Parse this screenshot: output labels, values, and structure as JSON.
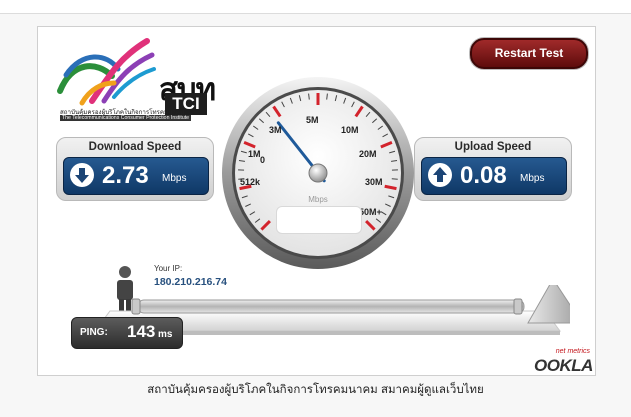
{
  "logo": {
    "brand_big": "สบท",
    "brand_small": "TCI",
    "thai_name": "สถาบันคุ้มครองผู้บริโภคในกิจการโทรคมนาคม",
    "english_name": "The Telecommunications Consumer Protection Institute"
  },
  "restart_label": "Restart Test",
  "download": {
    "title": "Download Speed",
    "value": "2.73",
    "unit": "Mbps"
  },
  "upload": {
    "title": "Upload Speed",
    "value": "0.08",
    "unit": "Mbps"
  },
  "gauge": {
    "unit": "Mbps",
    "needle_value_mbps": 2.73,
    "labels": {
      "l0": "0",
      "l512": "512k",
      "l1": "1M",
      "l3": "3M",
      "l5": "5M",
      "l10": "10M",
      "l20": "20M",
      "l30": "30M",
      "l50": "50M+"
    }
  },
  "ip": {
    "label": "Your IP:",
    "value": "180.210.216.74"
  },
  "ping": {
    "label": "PING:",
    "value": "143",
    "unit": "ms"
  },
  "ookla": {
    "small": "net metrics",
    "big": "OOKLA"
  },
  "caption": "สถาบันคุ้มครองผู้บริโภคในกิจการโทรคมนาคม สมาคมผู้ดูแลเว็บไทย",
  "colors": {
    "accent_blue": "#1e4c80",
    "restart_red": "#7e1a1a",
    "scale_red": "#d3232c",
    "needle": "#1f5a9a"
  },
  "icons": {
    "download": "down-arrow-circle-icon",
    "upload": "up-arrow-circle-icon"
  }
}
